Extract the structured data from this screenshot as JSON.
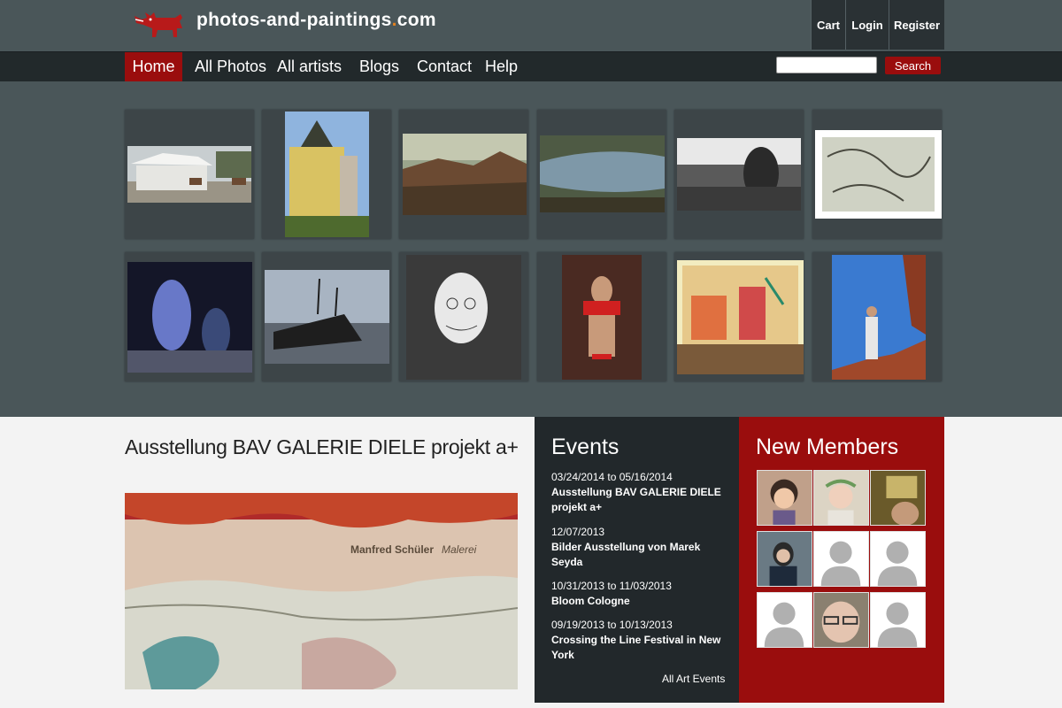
{
  "header": {
    "site_name_main": "photos-and-paintings",
    "site_name_dot": ".",
    "site_name_tld": "com",
    "buttons": {
      "cart": "Cart",
      "login": "Login",
      "register": "Register"
    }
  },
  "nav": {
    "items": [
      "Home",
      "All Photos",
      "All artists",
      "Blogs",
      "Contact",
      "Help"
    ],
    "active": "Home",
    "search_placeholder": "",
    "search_button": "Search"
  },
  "gallery": {
    "rows": [
      [
        "white-pavilion-horses-photo",
        "yellow-palace-statue-photo",
        "valley-landscape-photo",
        "river-stream-photo",
        "woman-bw-photo",
        "abstract-drawing-photo"
      ],
      [
        "night-figures-sculpture-photo",
        "shipwreck-sunset-photo",
        "face-sketch-photo",
        "red-bikini-model-photo",
        "colorful-town-painting-photo",
        "woman-red-cliff-photo"
      ]
    ]
  },
  "feature": {
    "title": "Ausstellung BAV GALERIE DIELE projekt a+",
    "image_text_artist": "Manfred Schüler",
    "image_text_suffix": "Malerei"
  },
  "events": {
    "title": "Events",
    "items": [
      {
        "date": "03/24/2014 to 05/16/2014",
        "name": "Ausstellung BAV GALERIE DIELE projekt a+"
      },
      {
        "date": "12/07/2013",
        "name": "Bilder Ausstellung von Marek Seyda"
      },
      {
        "date": "10/31/2013 to 11/03/2013",
        "name": "Bloom Cologne"
      },
      {
        "date": "09/19/2013 to 10/13/2013",
        "name": "Crossing the Line Festival in New York"
      }
    ],
    "all_link": "All Art Events"
  },
  "members": {
    "title": "New Members",
    "avatars": [
      "cartoon-girl-avatar",
      "girl-flower-crown-avatar",
      "sign-photo-avatar",
      "woman-sitting-avatar",
      "default-avatar",
      "default-avatar",
      "default-avatar",
      "man-glasses-avatar",
      "default-avatar"
    ]
  },
  "colors": {
    "brand_red": "#9a0d0d",
    "header_bg": "#4a5659",
    "nav_bg": "#22292b"
  }
}
